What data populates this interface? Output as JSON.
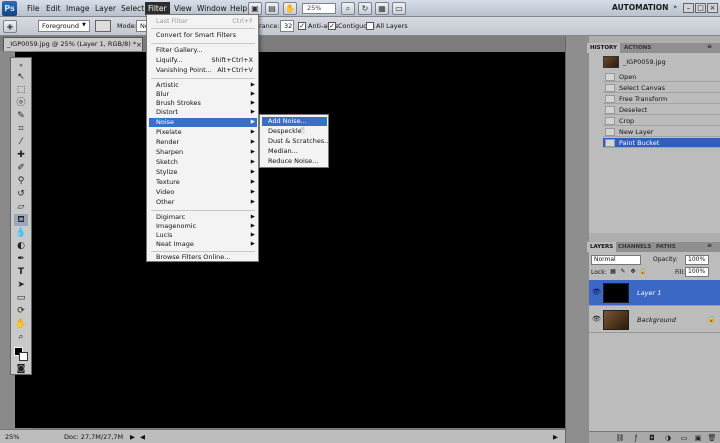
{
  "app": {
    "logo": "Ps"
  },
  "menubar": {
    "items": [
      "File",
      "Edit",
      "Image",
      "Layer",
      "Select",
      "Filter",
      "View",
      "Window",
      "Help"
    ],
    "zoom": "25%",
    "workspace": "AUTOMATION",
    "window_controls": [
      "–",
      "□",
      "×"
    ]
  },
  "options": {
    "fill_source": "Foreground",
    "mode_label": "Mode:",
    "mode_value": "No",
    "tolerance_label": "rance:",
    "tolerance_value": "32",
    "anti_alias": "Anti-alias",
    "contiguous": "Contiguous",
    "all_layers": "All Layers"
  },
  "document": {
    "tab_title": "_IGP0059.jpg @ 25% (Layer 1, RGB/8) *",
    "close": "×"
  },
  "status": {
    "zoom": "25%",
    "doc": "Doc: 27,7M/27,7M"
  },
  "filter_menu": {
    "last_filter": "Last Filter",
    "last_filter_shortcut": "Ctrl+F",
    "smart_filters": "Convert for Smart Filters",
    "gallery": "Filter Gallery...",
    "liquify": "Liquify...",
    "liquify_shortcut": "Shift+Ctrl+X",
    "vanishing": "Vanishing Point...",
    "vanishing_shortcut": "Alt+Ctrl+V",
    "groups": [
      "Artistic",
      "Blur",
      "Brush Strokes",
      "Distort",
      "Noise",
      "Pixelate",
      "Render",
      "Sharpen",
      "Sketch",
      "Stylize",
      "Texture",
      "Video",
      "Other"
    ],
    "plugins": [
      "Digimarc",
      "Imagenomic",
      "Lucis",
      "Neat Image"
    ],
    "browse": "Browse Filters Online..."
  },
  "noise_menu": {
    "items": [
      "Add Noise...",
      "Despeckle",
      "Dust & Scratches...",
      "Median...",
      "Reduce Noise..."
    ]
  },
  "history": {
    "tabs": [
      "HISTORY",
      "ACTIONS"
    ],
    "snapshot": "_IGP0059.jpg",
    "steps": [
      "Open",
      "Select Canvas",
      "Free Transform",
      "Deselect",
      "Crop",
      "New Layer",
      "Paint Bucket"
    ]
  },
  "layers": {
    "tabs": [
      "LAYERS",
      "CHANNELS",
      "PATHS"
    ],
    "blend_mode": "Normal",
    "opacity_label": "Opacity:",
    "opacity": "100%",
    "lock_label": "Lock:",
    "fill_label": "Fill:",
    "fill": "100%",
    "rows": [
      "Layer 1",
      "Background"
    ]
  }
}
